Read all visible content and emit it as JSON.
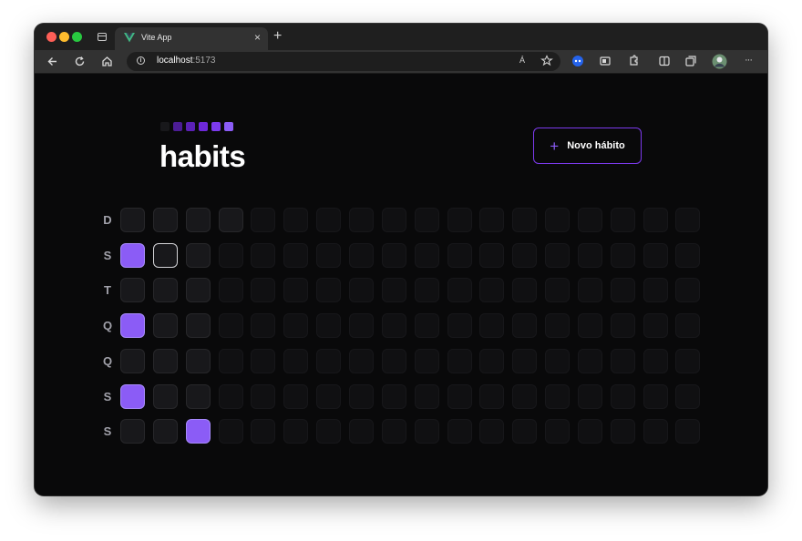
{
  "browser": {
    "tab_title": "Vite App",
    "tab_close": "×",
    "new_tab": "+",
    "url_host": "localhost",
    "url_port": ":5173",
    "more": "···",
    "read_aloud": "Á"
  },
  "header": {
    "brand": "habits",
    "logo_colors": [
      "#18181b",
      "#4c1d95",
      "#5b21b6",
      "#6d28d9",
      "#7c3aed",
      "#8b5cf6"
    ],
    "new_habit_label": "Novo hábito",
    "new_habit_icon": "+"
  },
  "colors": {
    "accent": "#8b5cf6",
    "background": "#09090a",
    "cell_empty": "#18181b"
  },
  "week_days": [
    "D",
    "S",
    "T",
    "Q",
    "Q",
    "S",
    "S"
  ],
  "summary": {
    "columns": 18,
    "past_day_count": 22,
    "today_index": 8,
    "completed_indexes": [
      1,
      3,
      5,
      20
    ]
  }
}
